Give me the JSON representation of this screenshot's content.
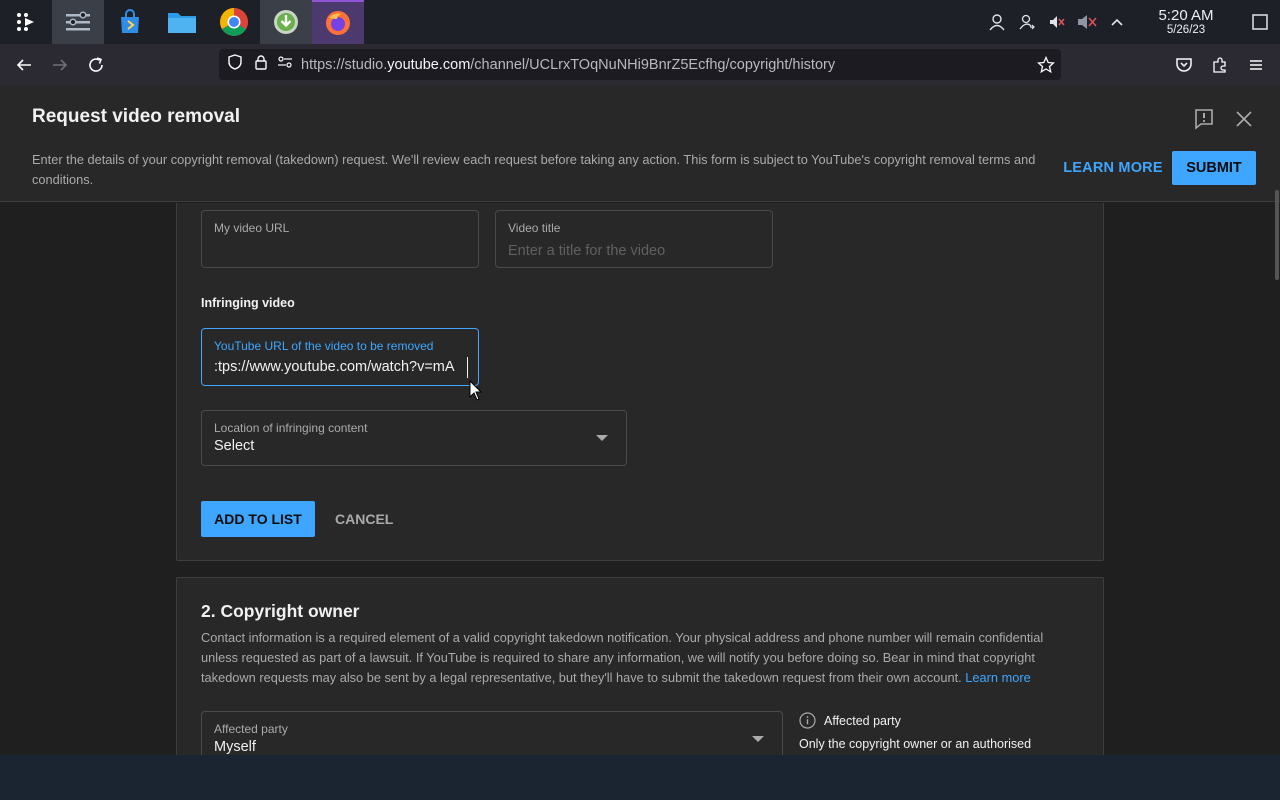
{
  "taskbar": {
    "apps": [
      {
        "name": "app-launcher-icon"
      },
      {
        "name": "system-settings-icon"
      },
      {
        "name": "store-icon"
      },
      {
        "name": "file-manager-icon"
      },
      {
        "name": "chrome-icon"
      },
      {
        "name": "download-manager-icon"
      },
      {
        "name": "firefox-icon"
      }
    ],
    "clock_time": "5:20 AM",
    "clock_date": "5/26/23"
  },
  "browser": {
    "url_prefix": "https://studio.",
    "url_domain": "youtube.com",
    "url_path": "/channel/UCLrxTOqNuNHi9BnrZ5Ecfhg/copyright/history"
  },
  "dialog": {
    "title": "Request video removal",
    "description": "Enter the details of your copyright removal (takedown) request. We'll review each request before taking any action. This form is subject to YouTube's copyright removal terms and conditions.",
    "learn_more": "LEARN MORE",
    "submit": "SUBMIT"
  },
  "section1": {
    "my_video_url_label": "My video URL",
    "my_video_url_value": "",
    "video_title_label": "Video title",
    "video_title_placeholder": "Enter a title for the video",
    "infringing_heading": "Infringing video",
    "infringing_url_label": "YouTube URL of the video to be removed",
    "infringing_url_value": ":tps://www.youtube.com/watch?v=mA",
    "location_label": "Location of infringing content",
    "location_value": "Select",
    "add_to_list": "ADD TO LIST",
    "cancel": "CANCEL"
  },
  "section2": {
    "title": "2. Copyright owner",
    "description": "Contact information is a required element of a valid copyright takedown notification. Your physical address and phone number will remain confidential unless requested as part of a lawsuit. If YouTube is required to share any information, we will notify you before doing so. Bear in mind that copyright takedown requests may also be sent by a legal representative, but they'll have to submit the takedown request from their own account.",
    "learn_more_link": "Learn more",
    "affected_party_label": "Affected party",
    "affected_party_value": "Myself",
    "info_heading": "Affected party",
    "info_body": "Only the copyright owner or an authorised"
  },
  "colors": {
    "accent": "#3ea6ff",
    "dialog_bg": "#282828",
    "page_bg": "#1f1f1f"
  }
}
